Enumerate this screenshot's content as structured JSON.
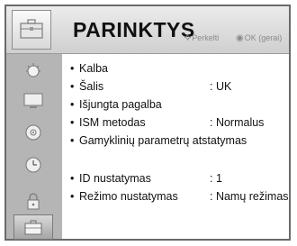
{
  "header": {
    "title": "PARINKTYS",
    "hint_move": "Perkelti",
    "hint_ok": "OK (gerai)",
    "move_glyph": "⯎",
    "ok_glyph": "◉"
  },
  "sidebar": {
    "items": [
      {
        "icon": "picture-settings-icon"
      },
      {
        "icon": "monitor-icon"
      },
      {
        "icon": "audio-disc-icon"
      },
      {
        "icon": "clock-icon"
      },
      {
        "icon": "lock-icon"
      },
      {
        "icon": "options-suitcase-icon",
        "selected": true
      }
    ]
  },
  "menu": {
    "bullet": "•",
    "items": [
      {
        "label": "Kalba",
        "value": ""
      },
      {
        "label": "Šalis",
        "value": ": UK"
      },
      {
        "label": "Išjungta pagalba",
        "value": ""
      },
      {
        "label": "ISM metodas",
        "value": ": Normalus"
      },
      {
        "label": "Gamyklinių parametrų atstatymas",
        "value": ""
      },
      {
        "label": "ID nustatymas",
        "value": ": 1"
      },
      {
        "label": "Režimo nustatymas",
        "value": ": Namų režimas"
      }
    ]
  },
  "colors": {
    "frame": "#6a6a6a",
    "sidebar": "#b5b5b5",
    "panel": "#ffffff",
    "text": "#111111",
    "hint": "#8a8a8a"
  }
}
